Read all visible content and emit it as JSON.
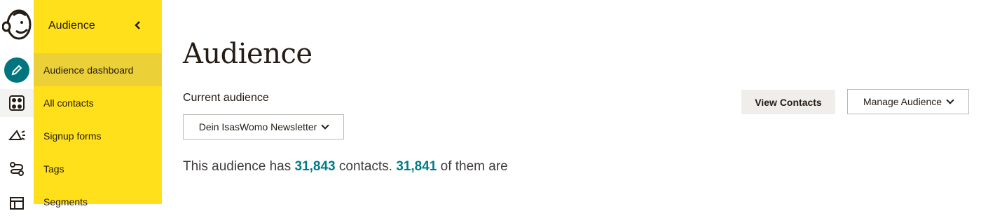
{
  "sidebar": {
    "title": "Audience",
    "items": [
      {
        "label": "Audience dashboard"
      },
      {
        "label": "All contacts"
      },
      {
        "label": "Signup forms"
      },
      {
        "label": "Tags"
      },
      {
        "label": "Segments"
      }
    ]
  },
  "rail": {
    "icons": [
      "mailchimp-logo",
      "create-pencil-icon",
      "audience-icon",
      "campaigns-megaphone-icon",
      "automations-icon",
      "website-icon"
    ]
  },
  "main": {
    "title": "Audience",
    "current_audience_label": "Current audience",
    "audience_select_value": "Dein IsasWomo Newsletter",
    "summary": {
      "prefix": "This audience has",
      "contacts_count": "31,843",
      "middle": "contacts.",
      "subscribed_count": "31,841",
      "suffix": "of them are"
    },
    "view_contacts_label": "View Contacts",
    "manage_audience_label": "Manage Audience"
  },
  "colors": {
    "sidebar_bg": "#ffe01b",
    "sidebar_active": "#ecd038",
    "accent_teal": "#007c89",
    "create_button": "#00757f"
  }
}
